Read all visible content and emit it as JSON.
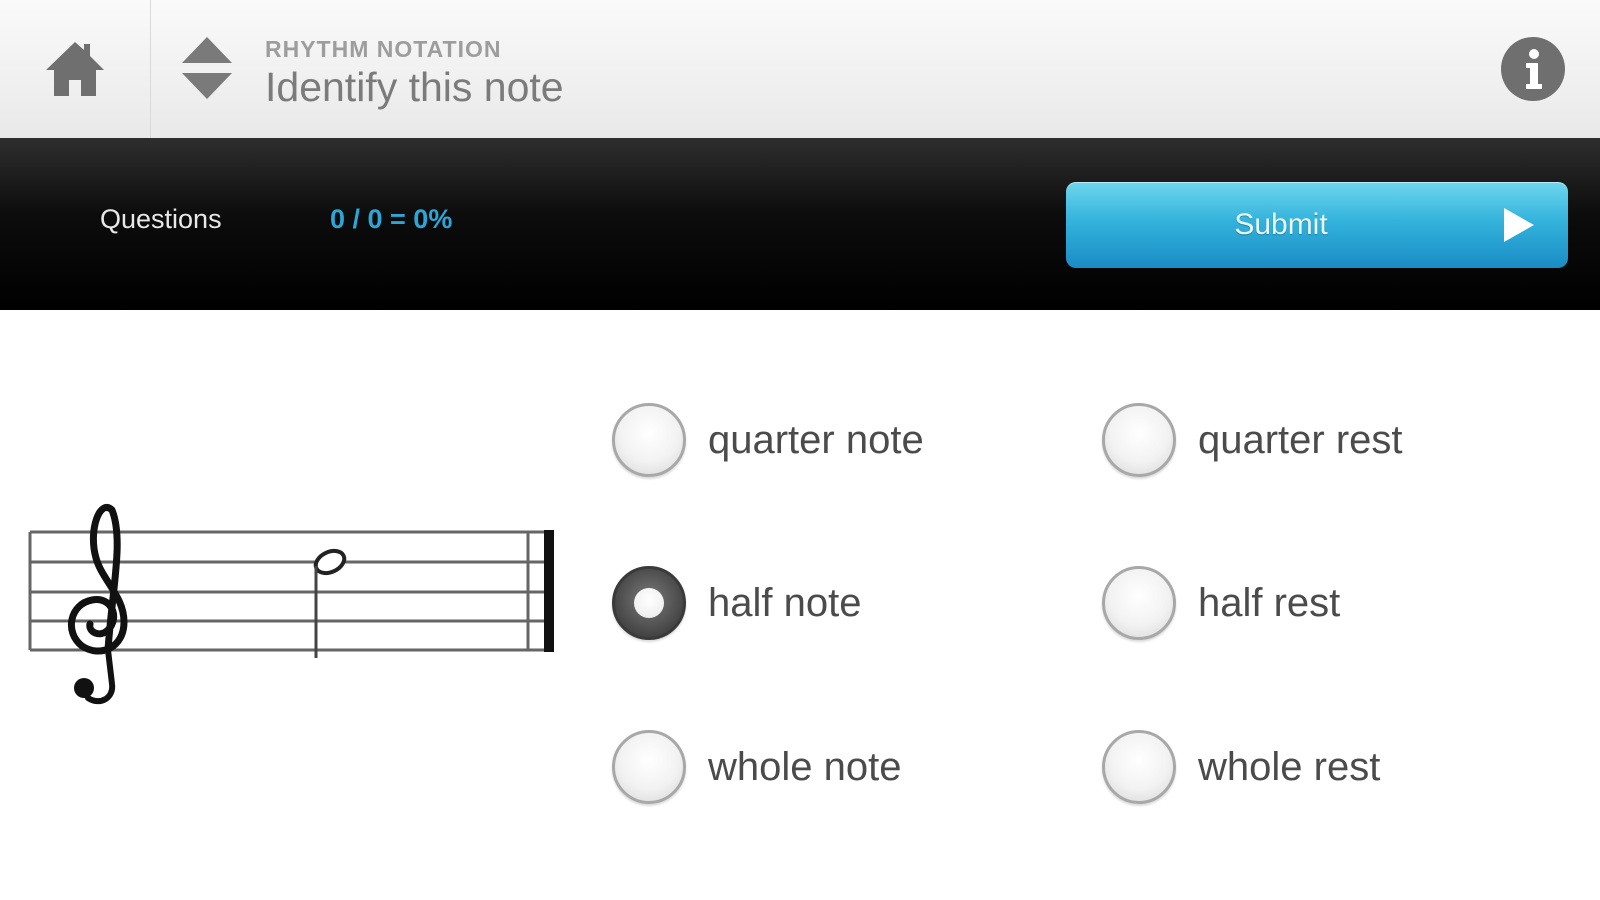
{
  "header": {
    "subtitle": "RHYTHM NOTATION",
    "title": "Identify this note",
    "icons": {
      "home": "home-icon",
      "nav": "up-down-arrows-icon",
      "info": "info-icon"
    }
  },
  "toolbar": {
    "questions_label": "Questions",
    "score": "0 / 0 = 0%",
    "submit_label": "Submit",
    "submit_icon": "play-arrow-icon",
    "accent_color": "#2aa6d8"
  },
  "staff": {
    "clef": "treble-clef-icon",
    "note": "half-note-icon"
  },
  "options": [
    {
      "label": "quarter note",
      "checked": false
    },
    {
      "label": "quarter rest",
      "checked": false
    },
    {
      "label": "half note",
      "checked": true
    },
    {
      "label": "half rest",
      "checked": false
    },
    {
      "label": "whole note",
      "checked": false
    },
    {
      "label": "whole rest",
      "checked": false
    }
  ]
}
